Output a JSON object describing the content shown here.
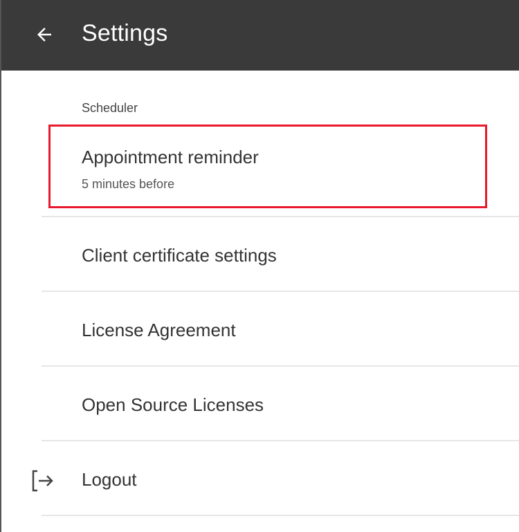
{
  "appbar": {
    "title": "Settings",
    "back_icon": "arrow-left-icon"
  },
  "scheduler": {
    "section_label": "Scheduler",
    "appointment_reminder": {
      "title": "Appointment reminder",
      "subtitle": "5 minutes before"
    }
  },
  "items": {
    "client_certificate": "Client certificate settings",
    "license_agreement": "License Agreement",
    "open_source": "Open Source Licenses",
    "logout": "Logout",
    "logout_icon": "logout-icon"
  },
  "colors": {
    "appbar_bg": "#3a3a3a",
    "highlight_border": "#e8192c",
    "text_primary": "#333333"
  }
}
